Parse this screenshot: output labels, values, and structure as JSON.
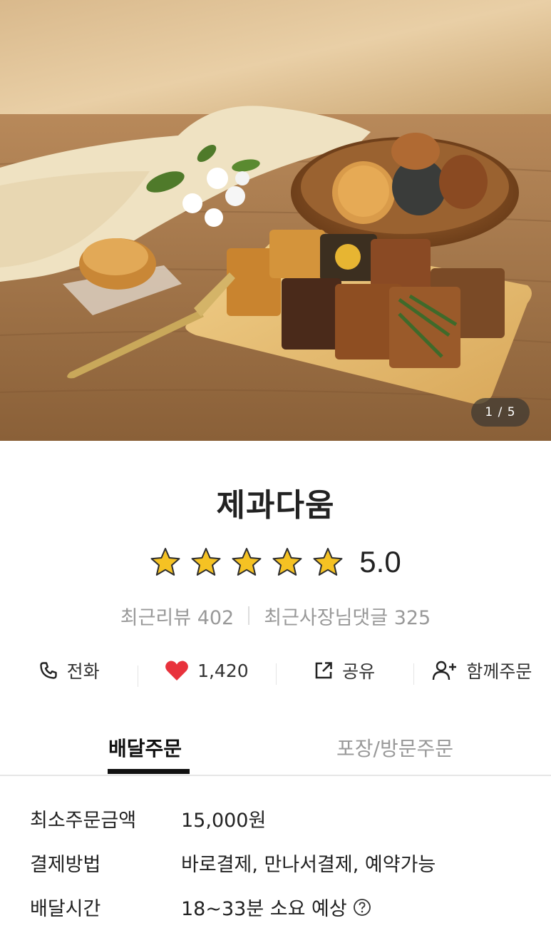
{
  "hero": {
    "image_counter": "1 / 5"
  },
  "store": {
    "name": "제과다움"
  },
  "rating": {
    "stars": 5,
    "max_stars": 5,
    "value": "5.0"
  },
  "reviews": {
    "recent_reviews": "최근리뷰 402",
    "owner_replies": "최근사장님댓글 325"
  },
  "actions": {
    "call_label": "전화",
    "like_count": "1,420",
    "share_label": "공유",
    "group_order_label": "함께주문"
  },
  "tabs": {
    "delivery": "배달주문",
    "pickup": "포장/방문주문",
    "active": "delivery"
  },
  "info": [
    {
      "label": "최소주문금액",
      "value": "15,000원"
    },
    {
      "label": "결제방법",
      "value": "바로결제, 만나서결제, 예약가능"
    },
    {
      "label": "배달시간",
      "value": "18~33분 소요 예상"
    }
  ],
  "colors": {
    "heart": "#e8323c",
    "star": "#f5c223",
    "text_muted": "#999999",
    "tab_active": "#111111"
  }
}
